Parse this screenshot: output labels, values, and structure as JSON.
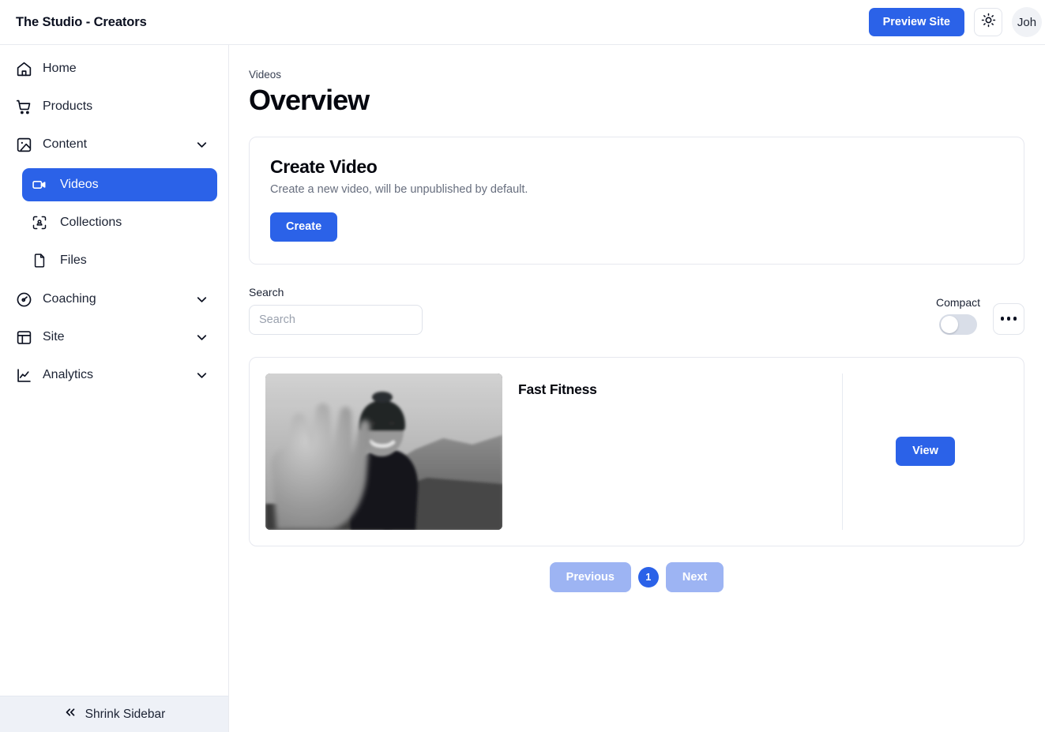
{
  "header": {
    "title": "The Studio - Creators",
    "preview_label": "Preview Site",
    "theme_icon": "sun-icon",
    "avatar_initials": "Joh"
  },
  "sidebar": {
    "items": [
      {
        "label": "Home",
        "icon": "home-icon",
        "expandable": false
      },
      {
        "label": "Products",
        "icon": "shopping-cart-icon",
        "expandable": false
      },
      {
        "label": "Content",
        "icon": "image-icon",
        "expandable": true
      },
      {
        "label": "Coaching",
        "icon": "gauge-icon",
        "expandable": true
      },
      {
        "label": "Site",
        "icon": "layout-icon",
        "expandable": true
      },
      {
        "label": "Analytics",
        "icon": "chart-line-icon",
        "expandable": true
      }
    ],
    "content_children": [
      {
        "label": "Videos",
        "icon": "video-camera-icon",
        "active": true
      },
      {
        "label": "Collections",
        "icon": "collections-icon",
        "active": false
      },
      {
        "label": "Files",
        "icon": "file-icon",
        "active": false
      }
    ],
    "footer": {
      "label": "Shrink Sidebar",
      "icon": "chevrons-left-icon"
    }
  },
  "main": {
    "breadcrumb": "Videos",
    "title": "Overview",
    "create_card": {
      "title": "Create Video",
      "subtitle": "Create a new video, will be unpublished by default.",
      "button_label": "Create"
    },
    "filters": {
      "search_label": "Search",
      "search_value": "",
      "search_placeholder": "Search",
      "compact_label": "Compact",
      "compact_on": false,
      "more_icon": "ellipsis-icon"
    },
    "videos": [
      {
        "title": "Fast Fitness",
        "thumbnail_alt": "Black and white photo of a smiling person in a beanie waving at the camera outdoors",
        "action_label": "View"
      }
    ],
    "pagination": {
      "previous_label": "Previous",
      "next_label": "Next",
      "current_page": "1"
    }
  },
  "colors": {
    "brand_blue": "#2b62e8",
    "pager_disabled_blue": "#9db4f3",
    "border": "#e6e8ef",
    "muted_text": "#676e7e",
    "sidebar_footer_bg": "#eef1f7"
  }
}
